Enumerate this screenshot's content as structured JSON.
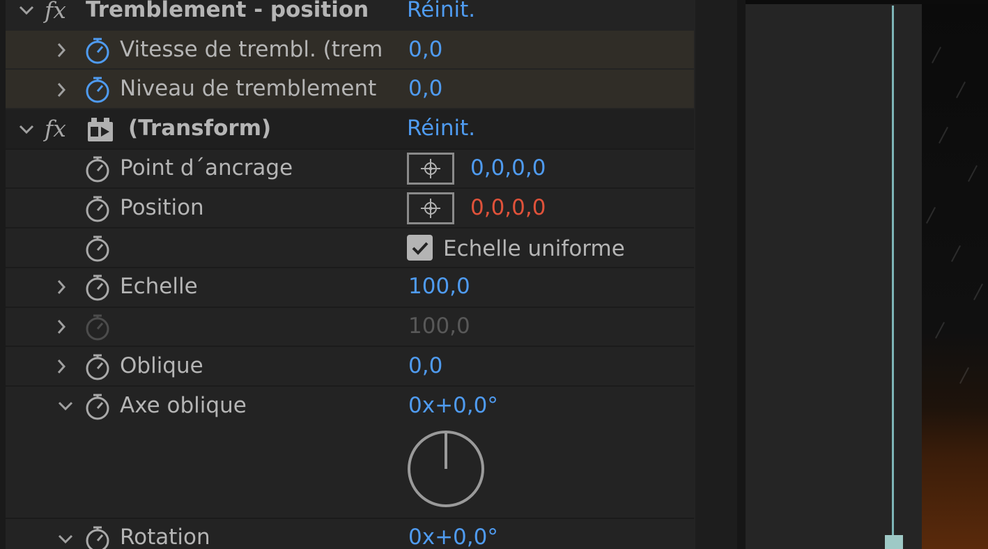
{
  "effects": [
    {
      "header_label": "Tremblement - position",
      "reset_label": "Réinit.",
      "properties": [
        {
          "label": "Vitesse de trembl. (trem",
          "value": "0,0"
        },
        {
          "label": "Niveau de tremblement",
          "value": "0,0"
        }
      ]
    },
    {
      "header_label": "(Transform)",
      "reset_label": "Réinit.",
      "properties": [
        {
          "label": "Point d´ancrage",
          "value": "0,0,0,0"
        },
        {
          "label": "Position",
          "value": "0,0,0,0"
        },
        {
          "label": "",
          "checkbox_label": "Echelle uniforme",
          "checked": true
        },
        {
          "label": "Echelle",
          "value": "100,0"
        },
        {
          "label": "",
          "value": "100,0",
          "disabled": true
        },
        {
          "label": "Oblique",
          "value": "0,0"
        },
        {
          "label": "Axe oblique",
          "value": "0x+0,0°",
          "dial_angle_deg": 0
        },
        {
          "label": "Rotation",
          "value": "0x+0,0°"
        }
      ]
    }
  ],
  "colors": {
    "value_blue": "#4f9bf0",
    "value_red": "#e0523a",
    "highlight_row": "#302d27",
    "panel_bg": "#232323",
    "playhead": "#7eb5b7"
  },
  "icons": {
    "stopwatch": "stopwatch-icon",
    "expand": "chevron-right-icon",
    "collapse": "chevron-down-icon",
    "fx": "fx-icon",
    "crosshair": "crosshair-icon",
    "check": "check-icon"
  }
}
